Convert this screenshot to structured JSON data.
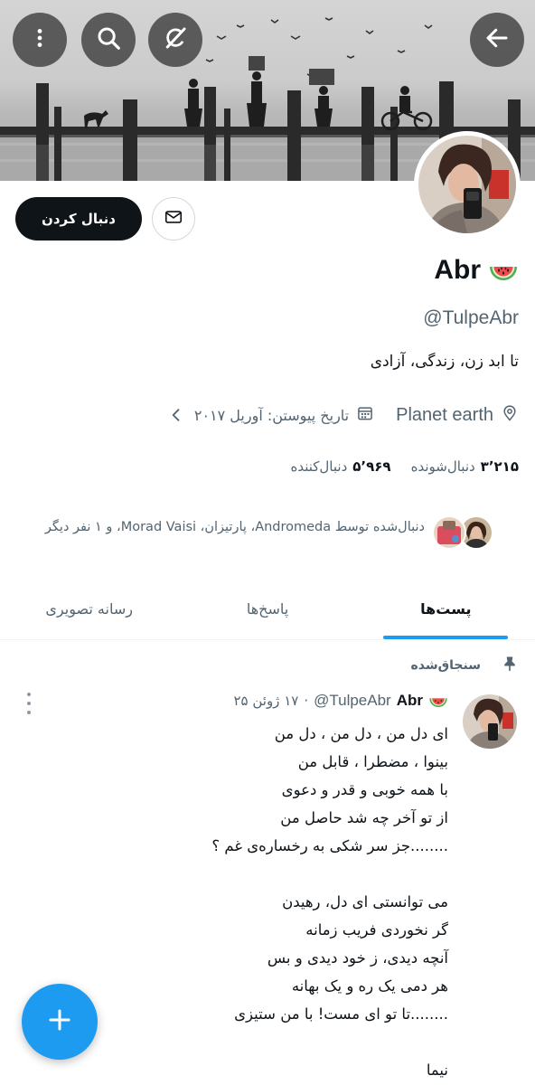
{
  "header": {
    "back_icon": "arrow-left-icon",
    "grok_icon": "grok-icon",
    "search_icon": "search-icon",
    "more_icon": "vertical-dots-icon"
  },
  "profile": {
    "display_name": "Abr",
    "name_emoji": "🍉",
    "handle": "@TulpeAbr",
    "bio": "تا ابد زن، زندگی، آزادی",
    "location": "Planet earth",
    "joined": "تاریخ پیوستن: آوریل ۲۰۱۷",
    "follow_label": "دنبال کردن",
    "message_icon": "envelope-icon",
    "following_count": "۳٬۲۱۵",
    "following_label": "دنبال‌شونده",
    "followers_count": "۵٬۹۶۹",
    "followers_label": "دنبال‌کننده",
    "followed_by_text": "دنبال‌شده توسط Andromeda، پارتیزان، Morad Vaisi، و ۱ نفر دیگر"
  },
  "tabs": [
    {
      "label": "پست‌ها",
      "active": true
    },
    {
      "label": "پاسخ‌ها",
      "active": false
    },
    {
      "label": "رسانه تصویری",
      "active": false
    }
  ],
  "pinned_post": {
    "pinned_label": "سنجاق‌شده",
    "author_name": "Abr",
    "author_emoji": "🍉",
    "author_handle": "@TulpeAbr",
    "separator": "·",
    "date": "۱۷ ژوئن ۲۵",
    "lines": [
      "ای دل من ، دل من ، دل من",
      "بینوا ، مضطرا ، قابل من",
      "با همه خوبی و قدر و دعوی",
      "از تو آخر چه شد حاصل من",
      "........جز سر شکی به رخساره‌ی غم ؟",
      "",
      "می توانستی ای دل، رهیدن",
      "گر نخوردی فریب زمانه",
      "آنچه دیدی، ز خود دیدی و بس",
      "هر دمی یک ره و یک بهانه",
      "........تا تو ای مست! با من ستیزی",
      "",
      "نیما"
    ]
  },
  "fab": {
    "icon": "plus-icon"
  },
  "colors": {
    "accent": "#1d9bf0",
    "text": "#0f1419",
    "muted": "#536471"
  }
}
